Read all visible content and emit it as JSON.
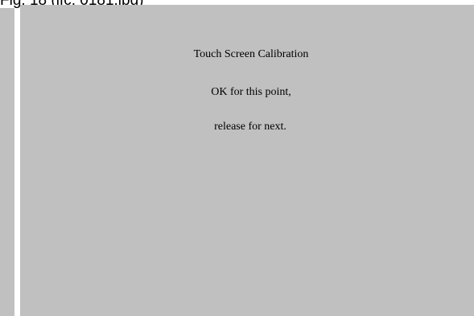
{
  "caption": "Fig. 18 (ifc. 0181.jpg)",
  "calibration": {
    "title": "Touch Screen Calibration",
    "line1": "OK for this point,",
    "line2": "release for next."
  },
  "colors": {
    "screen_background": "#c0c0c0",
    "text": "#000000",
    "page_background": "#ffffff"
  }
}
